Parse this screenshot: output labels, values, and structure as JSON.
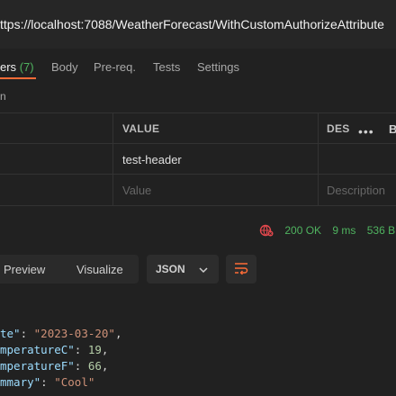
{
  "url": "ttps://localhost:7088/WeatherForecast/WithCustomAuthorizeAttribute",
  "tabs": {
    "headers_partial": "ers",
    "headers_count": "(7)",
    "body": "Body",
    "prereq": "Pre-req.",
    "tests": "Tests",
    "settings": "Settings"
  },
  "sub_label": "n",
  "table": {
    "col_value": "VALUE",
    "col_desc": "DES",
    "more": "•••",
    "bulk": "B",
    "row1_value": "test-header",
    "value_placeholder": "Value",
    "desc_placeholder": "Description"
  },
  "status": {
    "code": "200 OK",
    "time": "9 ms",
    "size": "536 B"
  },
  "response_toolbar": {
    "preview": "Preview",
    "visualize": "Visualize",
    "format": "JSON"
  },
  "code_lines": [
    {
      "key": "te\"",
      "sep": ": ",
      "val": "\"2023-03-20\"",
      "type": "str",
      "tail": ","
    },
    {
      "key": "mperatureC\"",
      "sep": ": ",
      "val": "19",
      "type": "num",
      "tail": ","
    },
    {
      "key": "mperatureF\"",
      "sep": ": ",
      "val": "66",
      "type": "num",
      "tail": ","
    },
    {
      "key": "mmary\"",
      "sep": ": ",
      "val": "\"Cool\"",
      "type": "str",
      "tail": ""
    }
  ]
}
